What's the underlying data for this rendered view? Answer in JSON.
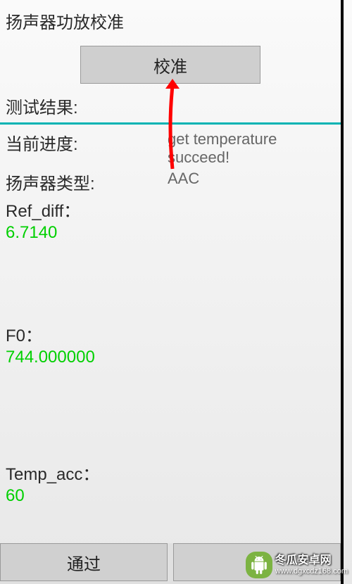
{
  "header": {
    "title": "扬声器功放校准",
    "calibrate_button": "校准",
    "result_label": "测试结果:"
  },
  "progress": {
    "label": "当前进度:",
    "value": "get temperature succeed!"
  },
  "speaker_type": {
    "label": "扬声器类型:",
    "value": "AAC"
  },
  "ref_diff": {
    "label": "Ref_diff：",
    "value": "6.7140"
  },
  "f0": {
    "label": "F0：",
    "value": "744.000000"
  },
  "temp_acc": {
    "label": "Temp_acc：",
    "value": "60"
  },
  "footer": {
    "pass": "通过"
  },
  "watermark": {
    "name": "冬瓜安卓网",
    "url": "www.dgxcdz168.com"
  }
}
